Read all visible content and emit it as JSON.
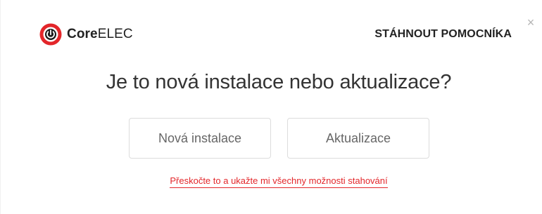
{
  "brand": {
    "name_bold": "Core",
    "name_light": "ELEC",
    "logo_icon": "corelec-power-logo-icon",
    "accent_color": "#e3262a"
  },
  "header": {
    "download_helper_label": "STÁHNOUT POMOCNÍKA",
    "close_icon": "close-icon",
    "close_glyph": "×"
  },
  "main": {
    "question": "Je to nová instalace nebo aktualizace?",
    "new_install_label": "Nová instalace",
    "update_label": "Aktualizace",
    "skip_link_label": "Přeskočte to a ukažte mi všechny možnosti stahování"
  }
}
